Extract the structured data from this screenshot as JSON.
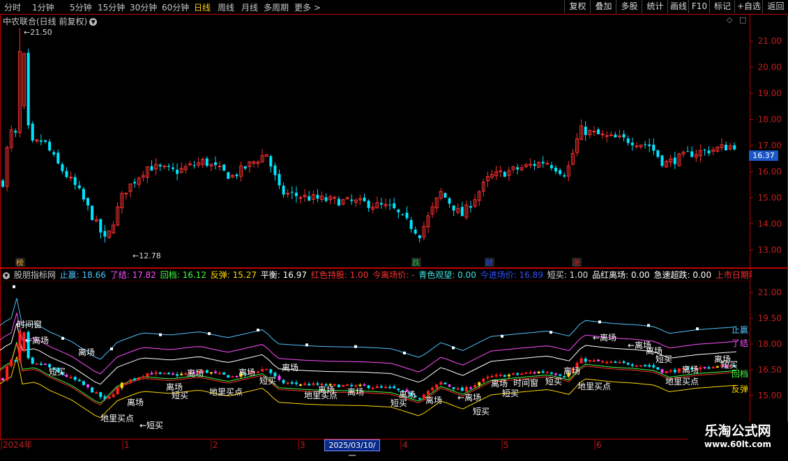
{
  "toolbar": {
    "periods": [
      "分时",
      "1分钟",
      "5分钟",
      "15分钟",
      "30分钟",
      "60分钟",
      "日线",
      "周线",
      "月线",
      "多周期",
      "更多 >"
    ],
    "active_period": "日线",
    "right_buttons": [
      "复权",
      "叠加",
      "多股",
      "统计",
      "画线",
      "F10",
      "标记",
      "+自选",
      "返回"
    ]
  },
  "main_chart": {
    "title": "中农联合(日线 前复权)",
    "current_price": "16.37",
    "high_label": "21.50",
    "low_label": "12.78",
    "y_ticks": [
      "21.00",
      "20.00",
      "19.00",
      "18.00",
      "17.00",
      "16.00",
      "15.00",
      "14.00",
      "13.00"
    ],
    "event_badges": [
      {
        "text": "榜",
        "color": "#e8a020"
      },
      {
        "text": "跌",
        "color": "#20c040"
      },
      {
        "text": "财",
        "color": "#2050ff"
      },
      {
        "text": "涨",
        "color": "#e02020"
      }
    ]
  },
  "indicator": {
    "name": "股朋指标网",
    "fields": [
      {
        "label": "止赢:",
        "value": "18.66",
        "color": "#4fc3ff"
      },
      {
        "label": "了结:",
        "value": "17.82",
        "color": "#ff4fff"
      },
      {
        "label": "回档:",
        "value": "16.12",
        "color": "#40ff40"
      },
      {
        "label": "反弹:",
        "value": "15.27",
        "color": "#ffd700"
      },
      {
        "label": "平衡:",
        "value": "16.97",
        "color": "#ffffff"
      },
      {
        "label": "红色持股:",
        "value": "1.00",
        "color": "#ff3030"
      },
      {
        "label": "今离场价:",
        "value": "-",
        "color": "#ff3030"
      },
      {
        "label": "青色观望:",
        "value": "0.00",
        "color": "#40e0e0"
      },
      {
        "label": "今进场价:",
        "value": "16.89",
        "color": "#3050ff"
      },
      {
        "label": "短买:",
        "value": "1.00",
        "color": "#dddddd"
      },
      {
        "label": "品红离场:",
        "value": "0.00",
        "color": "#ffffff"
      },
      {
        "label": "急速超跌:",
        "value": "0.00",
        "color": "#ffffff"
      },
      {
        "label": "上市日期年:",
        "value": "2023.00",
        "color": "#ff3030"
      }
    ],
    "y_ticks": [
      "21.00",
      "19.50",
      "18.00",
      "16.50",
      "15.00"
    ],
    "line_labels": [
      {
        "text": "止赢",
        "color": "#4fc3ff"
      },
      {
        "text": "了结",
        "color": "#ff4fff"
      },
      {
        "text": "回档",
        "color": "#40ff40"
      },
      {
        "text": "反弹",
        "color": "#ffd700"
      }
    ],
    "annotations": {
      "leave": "离场",
      "short_buy": "短买",
      "time_window": "时间窗",
      "hell_buy": "地里买点",
      "leave_arrow": "←离场",
      "short_buy_arrow": "←短买"
    }
  },
  "time_axis": {
    "labels": [
      "2024年",
      "1",
      "2",
      "3",
      "4",
      "5",
      "6"
    ],
    "cursor_date": "2025/03/10/一"
  },
  "watermark": {
    "line1": "乐淘公式网",
    "line2": "www.60lt.com"
  }
}
